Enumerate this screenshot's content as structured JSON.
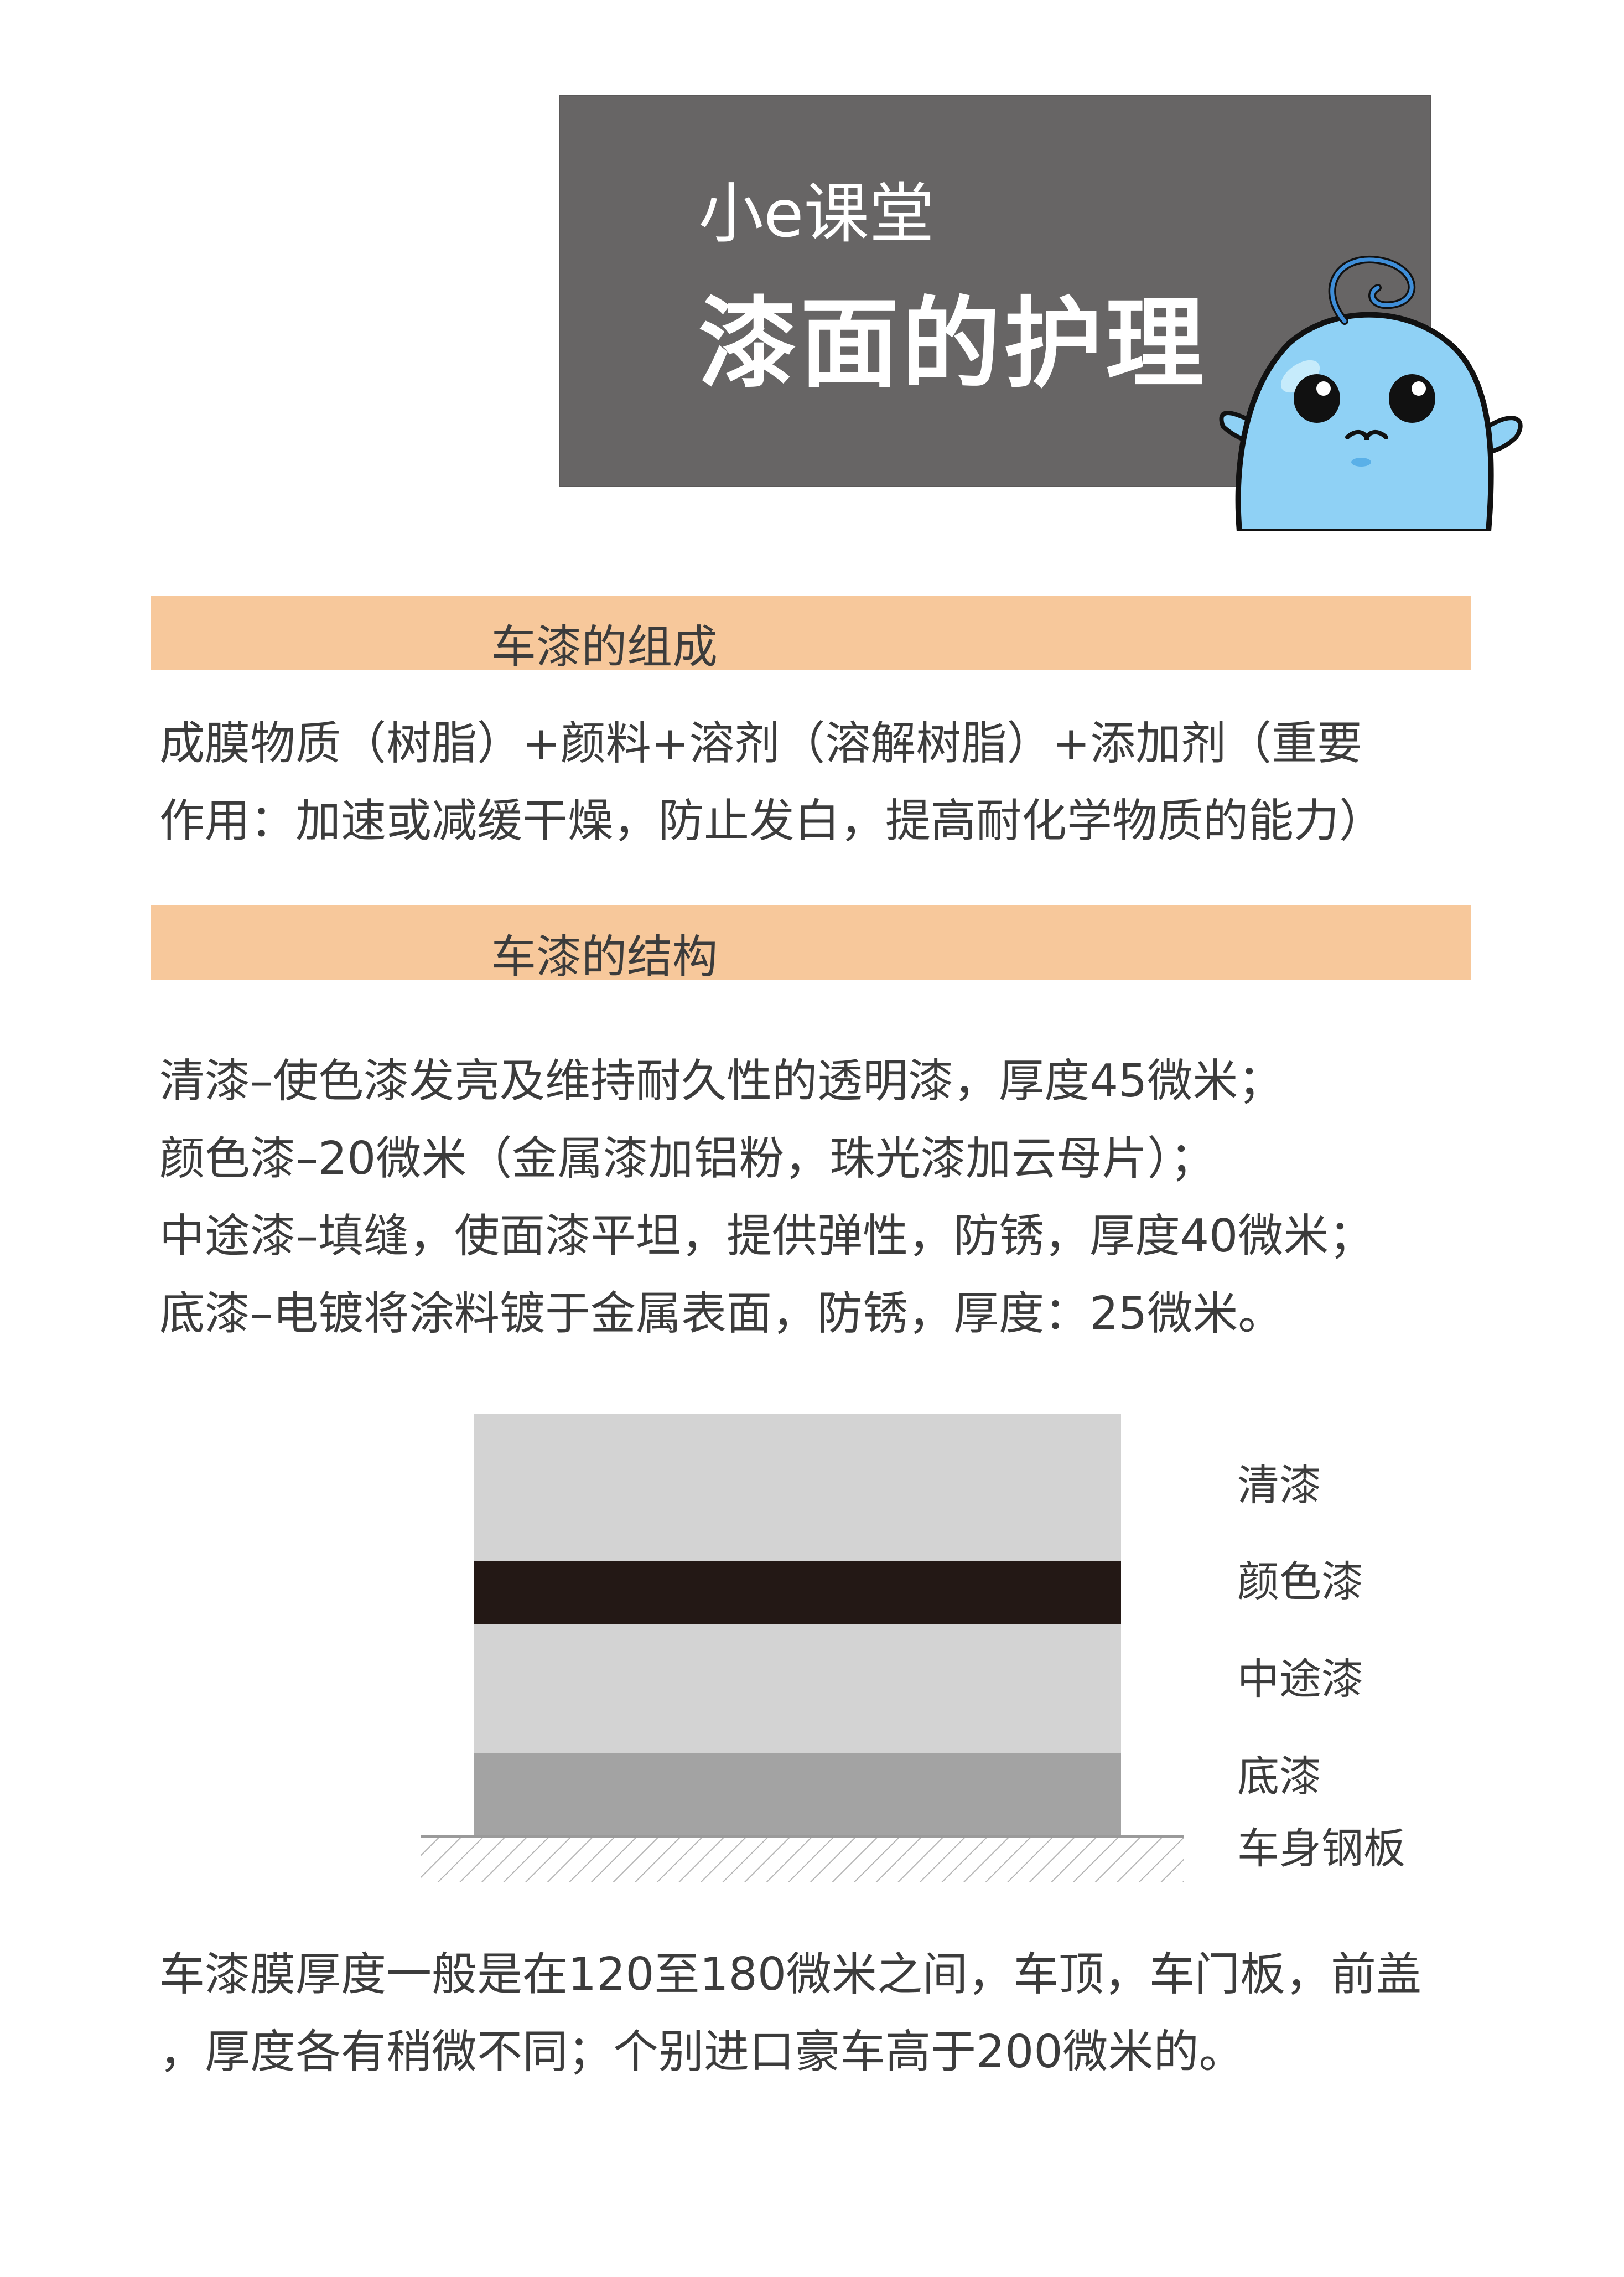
{
  "header": {
    "subtitle": "小e课堂",
    "title": "漆面的护理"
  },
  "sections": [
    {
      "heading": "车漆的组成",
      "lines": [
        "成膜物质（树脂）+颜料+溶剂（溶解树脂）+添加剂（重要",
        "作用：加速或减缓干燥，防止发白，提高耐化学物质的能力）"
      ]
    },
    {
      "heading": "车漆的结构",
      "lines": [
        "清漆–使色漆发亮及维持耐久性的透明漆，厚度45微米；",
        "颜色漆–20微米（金属漆加铝粉，珠光漆加云母片）；",
        "中途漆–填缝，使面漆平坦，提供弹性，防锈，厚度40微米；",
        "底漆–电镀将涂料镀于金属表面，防锈，厚度：25微米。"
      ]
    }
  ],
  "diagram": {
    "layers": [
      {
        "name": "清漆",
        "color": "#d3d3d3"
      },
      {
        "name": "颜色漆",
        "color": "#231815"
      },
      {
        "name": "中途漆",
        "color": "#d3d3d3"
      },
      {
        "name": "底漆",
        "color": "#a3a3a3"
      },
      {
        "name": "车身钢板",
        "color": "#b5b5b5"
      }
    ]
  },
  "footer": {
    "lines": [
      "车漆膜厚度一般是在120至180微米之间，车顶，车门板，前盖",
      "，厚度各有稍微不同；个别进口豪车高于200微米的。"
    ]
  },
  "colors": {
    "title_box": "#676565",
    "section_bar": "#f7c89b",
    "mascot": "#8fd1f5"
  }
}
